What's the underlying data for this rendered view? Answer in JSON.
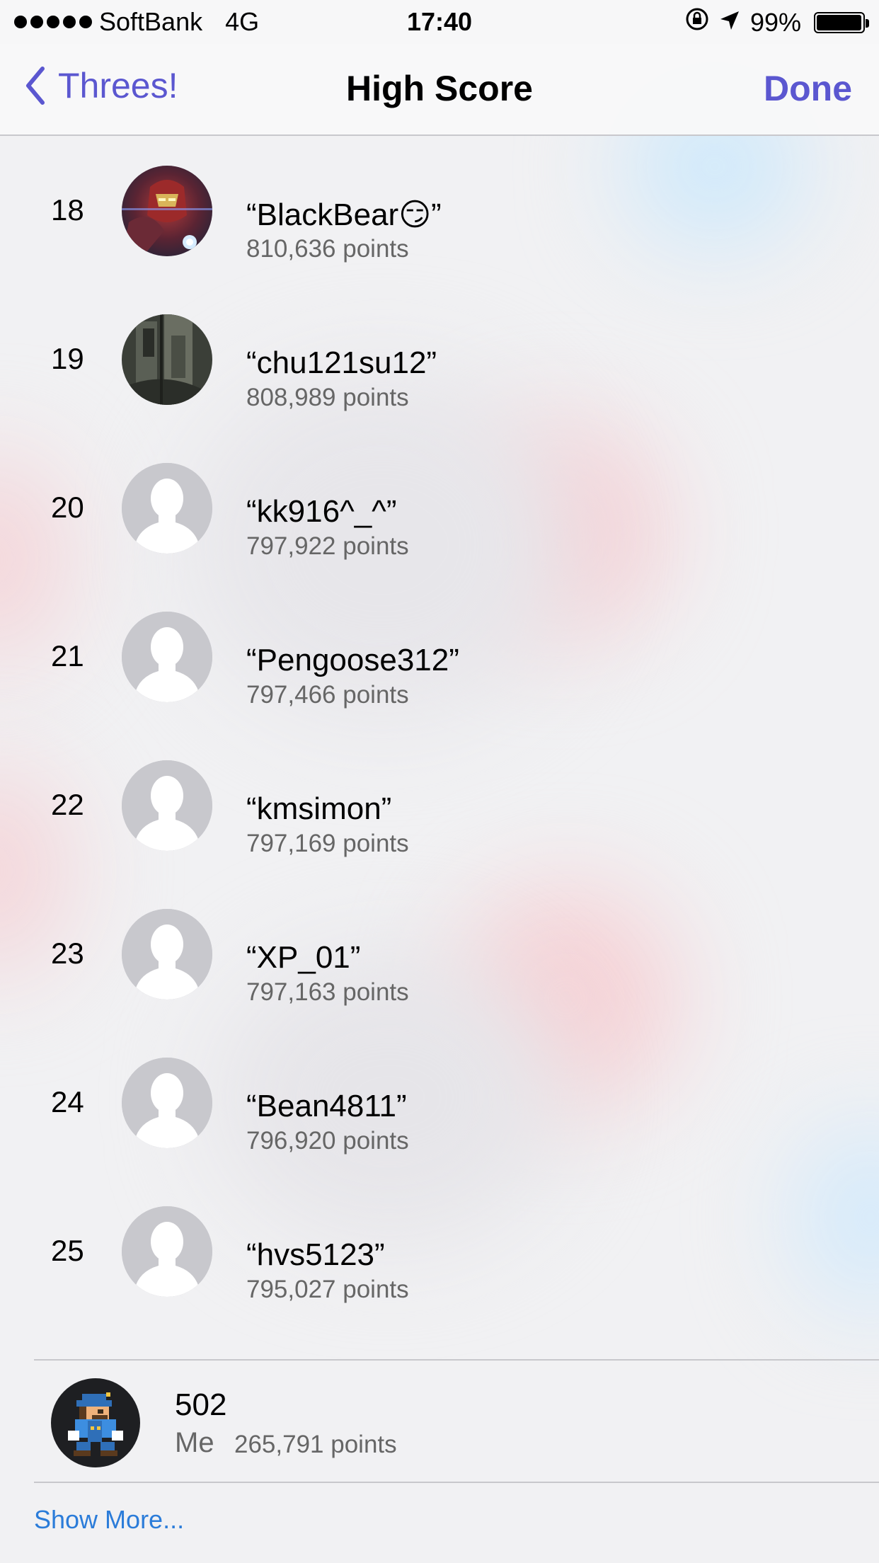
{
  "status_bar": {
    "signal_dots": 5,
    "carrier": "SoftBank",
    "network": "4G",
    "time": "17:40",
    "battery": "99%",
    "battery_level": 0.99,
    "icons": [
      "orientation-lock-icon",
      "location-arrow-icon",
      "battery-icon"
    ]
  },
  "nav": {
    "back_label": "Threes!",
    "title": "High Score",
    "done_label": "Done",
    "accent_color": "#5b57d0"
  },
  "entries": [
    {
      "rank": "18",
      "name": "“BlackBear😏”",
      "points": "810,636 points",
      "avatar": "photo-red-armor"
    },
    {
      "rank": "19",
      "name": "“chu121su12”",
      "points": "808,989 points",
      "avatar": "photo-dark-fabric"
    },
    {
      "rank": "20",
      "name": "“kk916^_^”",
      "points": "797,922 points",
      "avatar": "default-person"
    },
    {
      "rank": "21",
      "name": "“Pengoose312”",
      "points": "797,466 points",
      "avatar": "default-person"
    },
    {
      "rank": "22",
      "name": "“kmsimon”",
      "points": "797,169 points",
      "avatar": "default-person"
    },
    {
      "rank": "23",
      "name": "“XP_01”",
      "points": "797,163 points",
      "avatar": "default-person"
    },
    {
      "rank": "24",
      "name": "“Bean4811”",
      "points": "796,920 points",
      "avatar": "default-person"
    },
    {
      "rank": "25",
      "name": "“hvs5123”",
      "points": "795,027 points",
      "avatar": "default-person"
    }
  ],
  "me": {
    "rank": "502",
    "label": "Me",
    "points": "265,791 points",
    "avatar": "pixel-character"
  },
  "show_more": "Show More...",
  "link_color": "#2b7cd9"
}
